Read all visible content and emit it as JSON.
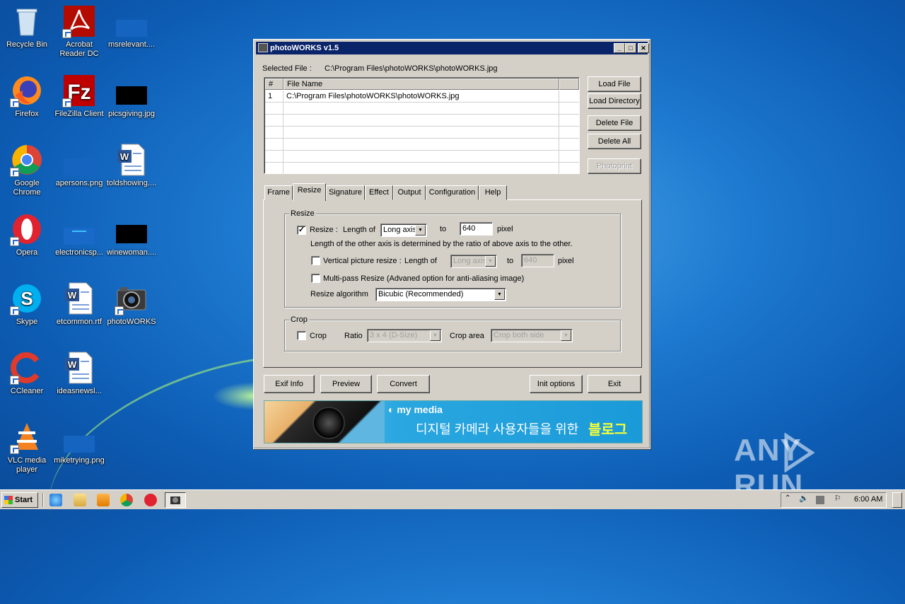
{
  "desktop": {
    "icons": [
      {
        "label": "Recycle Bin"
      },
      {
        "label": "Acrobat Reader DC"
      },
      {
        "label": "msrelevant...."
      },
      {
        "label": "Firefox"
      },
      {
        "label": "FileZilla Client"
      },
      {
        "label": "picsgiving.jpg"
      },
      {
        "label": "Google Chrome"
      },
      {
        "label": "apersons.png"
      },
      {
        "label": "toldshowing...."
      },
      {
        "label": "Opera"
      },
      {
        "label": "electronicsp..."
      },
      {
        "label": "winewoman...."
      },
      {
        "label": "Skype"
      },
      {
        "label": "etcommon.rtf"
      },
      {
        "label": "photoWORKS"
      },
      {
        "label": "CCleaner"
      },
      {
        "label": "ideasnewsl..."
      },
      {
        "label": "VLC media player"
      },
      {
        "label": "miketrying.png"
      }
    ]
  },
  "window": {
    "title": "photoWORKS v1.5",
    "controls": {
      "minimize": "_",
      "maximize": "□",
      "close": "✕"
    },
    "selected_file_label": "Selected File :",
    "selected_file_value": "C:\\Program Files\\photoWORKS\\photoWORKS.jpg",
    "grid": {
      "headers": [
        "#",
        "File Name"
      ],
      "rows": [
        {
          "num": "1",
          "file": "C:\\Program Files\\photoWORKS\\photoWORKS.jpg"
        }
      ]
    },
    "side_buttons": {
      "load_file": "Load File",
      "load_directory": "Load Directory",
      "delete_file": "Delete File",
      "delete_all": "Delete All",
      "photoprint": "Photoprint"
    },
    "tabs": [
      "Frame",
      "Resize",
      "Signature",
      "Effect",
      "Output",
      "Configuration",
      "Help"
    ],
    "active_tab": "Resize",
    "resize_group": {
      "title": "Resize",
      "resize_checked": "✓",
      "resize_label": "Resize :",
      "length_of": "Length of",
      "axis_value": "Long axis",
      "to": "to",
      "pixel_value": "640",
      "pixel": "pixel",
      "note": "Length of the other axis is determined by the ratio of above axis to the other.",
      "vertical_label": "Vertical picture resize :",
      "vertical_length_of": "Length of",
      "vertical_axis_value": "Long axis",
      "vertical_to": "to",
      "vertical_pixel_value": "640",
      "vertical_pixel": "pixel",
      "multipass_label": "Multi-pass Resize (Advaned option for anti-aliasing image)",
      "algorithm_label": "Resize algorithm",
      "algorithm_value": "Bicubic (Recommended)"
    },
    "crop_group": {
      "title": "Crop",
      "crop_label": "Crop",
      "ratio_label": "Ratio",
      "ratio_value": "3 x 4 (D-Size)",
      "crop_area_label": "Crop area",
      "crop_area_value": "Crop both side"
    },
    "bottom_buttons": {
      "exif_info": "Exif Info",
      "preview": "Preview",
      "convert": "Convert",
      "init_options": "Init options",
      "exit": "Exit"
    },
    "banner": {
      "brand": "my media",
      "text": "디지털 카메라 사용자들을 위한",
      "highlight": "블로그"
    }
  },
  "watermark": {
    "left": "ANY",
    "right": "RUN"
  },
  "taskbar": {
    "start_label": "Start",
    "clock": "6:00 AM"
  }
}
